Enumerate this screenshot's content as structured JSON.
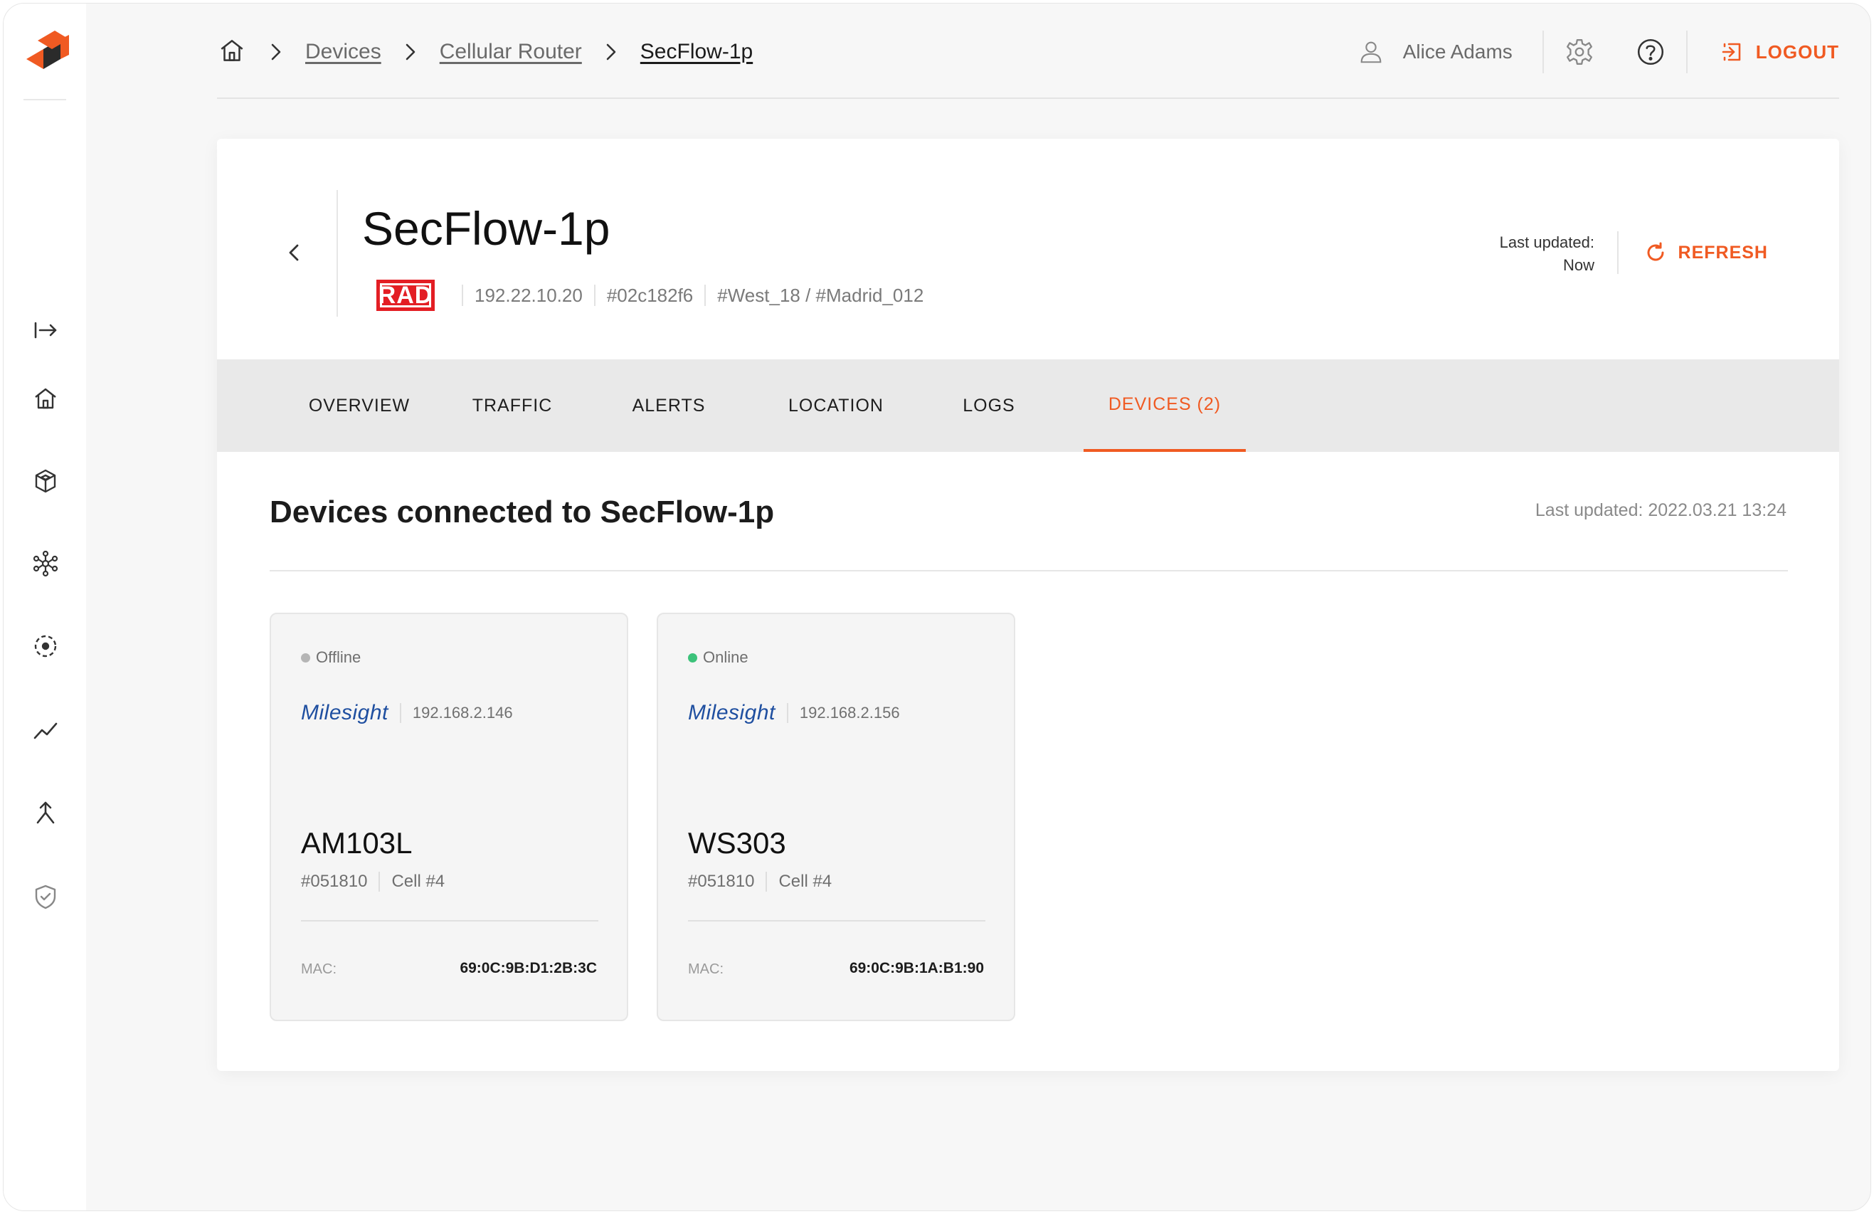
{
  "breadcrumbs": {
    "items": [
      "Devices",
      "Cellular Router"
    ],
    "current": "SecFlow-1p"
  },
  "user": {
    "name": "Alice Adams"
  },
  "header": {
    "logout_label": "LOGOUT"
  },
  "device": {
    "title": "SecFlow-1p",
    "brand_logo": "RAD",
    "ip": "192.22.10.20",
    "id": "#02c182f6",
    "location": "#West_18 / #Madrid_012",
    "last_updated_label": "Last updated:",
    "last_updated_value": "Now",
    "refresh_label": "REFRESH"
  },
  "tabs": [
    {
      "label": "OVERVIEW",
      "active": false
    },
    {
      "label": "TRAFFIC",
      "active": false
    },
    {
      "label": "ALERTS",
      "active": false
    },
    {
      "label": "LOCATION",
      "active": false
    },
    {
      "label": "LOGS",
      "active": false
    },
    {
      "label": "DEVICES (2)",
      "active": true
    }
  ],
  "section": {
    "title": "Devices connected to SecFlow-1p",
    "last_updated": "Last updated: 2022.03.21 13:24"
  },
  "connected_devices": [
    {
      "status": "Offline",
      "status_color": "#b5b5b5",
      "brand": "Milesight",
      "ip": "192.168.2.146",
      "name": "AM103L",
      "id": "#051810",
      "cell": "Cell #4",
      "mac_label": "MAC:",
      "mac": "69:0C:9B:D1:2B:3C"
    },
    {
      "status": "Online",
      "status_color": "#3cc27a",
      "brand": "Milesight",
      "ip": "192.168.2.156",
      "name": "WS303",
      "id": "#051810",
      "cell": "Cell #4",
      "mac_label": "MAC:",
      "mac": "69:0C:9B:1A:B1:90"
    }
  ],
  "colors": {
    "accent": "#f05a22",
    "tab_bar": "#e9e9e9"
  },
  "icons": {
    "sidebar": [
      "expand-icon",
      "home-icon",
      "cube-icon",
      "network-icon",
      "target-icon",
      "trend-icon",
      "merge-icon",
      "shield-icon"
    ]
  }
}
